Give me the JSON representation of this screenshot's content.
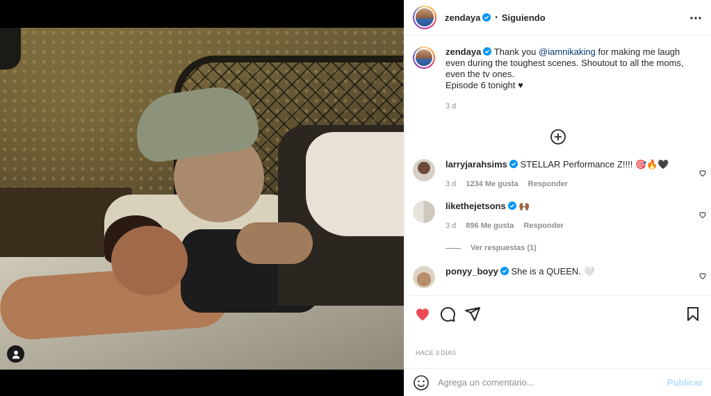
{
  "header": {
    "username": "zendaya",
    "follow_status": "Siguiendo",
    "dot": "•"
  },
  "caption": {
    "username": "zendaya",
    "text_before": "Thank you ",
    "mention": "@iamnikaking",
    "text_after": " for making me laugh even during the toughest scenes. Shoutout to all the moms, even the tv ones.",
    "line2": "Episode 6 tonight ♥",
    "time": "3 d"
  },
  "comments": [
    {
      "username": "larryjarahsims",
      "text": "STELLAR Performance Z!!!! 🎯🔥🖤",
      "time": "3 d",
      "likes": "1234 Me gusta",
      "reply": "Responder"
    },
    {
      "username": "likethejetsons",
      "text": "🙌🏾",
      "time": "3 d",
      "likes": "896 Me gusta",
      "reply": "Responder",
      "view_replies": "Ver respuestas (1)"
    },
    {
      "username": "ponyy_boyy",
      "text": "She is a QUEEN. 🤍"
    }
  ],
  "post": {
    "timestamp": "HACE 3 DÍAS"
  },
  "composer": {
    "placeholder": "Agrega un comentario...",
    "post_label": "Publicar"
  },
  "colors": {
    "like_red": "#ed4956",
    "link_blue": "#00376b",
    "verified_blue": "#0095f6",
    "publish_disabled": "#b3dbff"
  }
}
